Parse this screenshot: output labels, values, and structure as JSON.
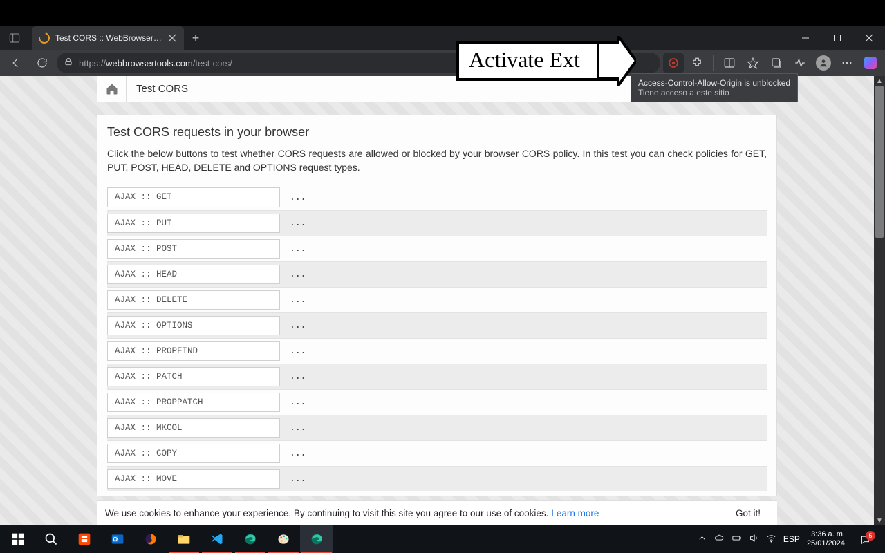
{
  "window": {
    "tab_title": "Test CORS :: WebBrowserTools",
    "url_prefix": "https://",
    "url_domain": "webbrowsertools.com",
    "url_path": "/test-cors/"
  },
  "callout": {
    "text": "Activate Ext"
  },
  "tooltip": {
    "line1": "Access-Control-Allow-Origin is unblocked",
    "line2": "Tiene acceso a este sitio"
  },
  "page": {
    "breadcrumb": "Test CORS",
    "heading": "Test CORS requests in your browser",
    "description": "Click the below buttons to test whether CORS requests are allowed or blocked by your browser CORS policy. In this test you can check policies for GET, PUT, POST, HEAD, DELETE and OPTIONS request types.",
    "methods": [
      {
        "label": "AJAX :: GET",
        "result": "..."
      },
      {
        "label": "AJAX :: PUT",
        "result": "..."
      },
      {
        "label": "AJAX :: POST",
        "result": "..."
      },
      {
        "label": "AJAX :: HEAD",
        "result": "..."
      },
      {
        "label": "AJAX :: DELETE",
        "result": "..."
      },
      {
        "label": "AJAX :: OPTIONS",
        "result": "..."
      },
      {
        "label": "AJAX :: PROPFIND",
        "result": "..."
      },
      {
        "label": "AJAX :: PATCH",
        "result": "..."
      },
      {
        "label": "AJAX :: PROPPATCH",
        "result": "..."
      },
      {
        "label": "AJAX :: MKCOL",
        "result": "..."
      },
      {
        "label": "AJAX :: COPY",
        "result": "..."
      },
      {
        "label": "AJAX :: MOVE",
        "result": "..."
      }
    ]
  },
  "cookie": {
    "text": "We use cookies to enhance your experience. By continuing to visit this site you agree to our use of cookies.",
    "link": "Learn more",
    "accept": "Got it!"
  },
  "systray": {
    "lang": "ESP",
    "time": "3:36 a. m.",
    "date": "25/01/2024",
    "notif_count": "5"
  }
}
